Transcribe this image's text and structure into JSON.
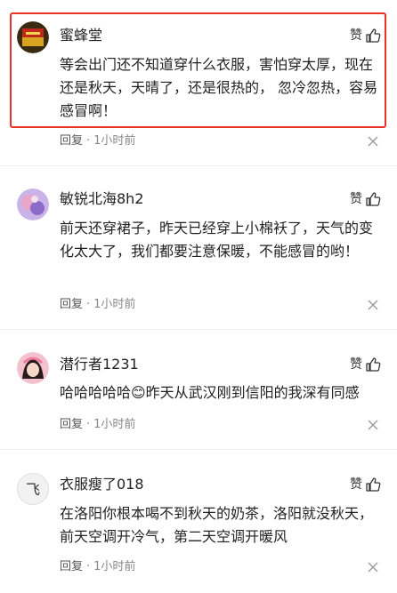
{
  "comments": [
    {
      "username": "蜜蜂堂",
      "like_label": "赞",
      "content": "等会出门还不知道穿什么衣服，害怕穿太厚，现在还是秋天，天晴了，还是很热的， 忽冷忽热，容易感冒啊！",
      "reply_label": "回复",
      "separator": "·",
      "time": "1小时前",
      "avatar_colors": [
        "#3a2a12",
        "#d9a520"
      ]
    },
    {
      "username": "敏锐北海8h2",
      "like_label": "赞",
      "content": "前天还穿裙子，昨天已经穿上小棉袄了，天气的变化太大了，我们都要注意保暖，不能感冒的哟！",
      "reply_label": "回复",
      "separator": "·",
      "time": "1小时前",
      "avatar_colors": [
        "#b8a0e0",
        "#e8a6c8"
      ]
    },
    {
      "username": "潜行者1231",
      "like_label": "赞",
      "content": "哈哈哈哈哈😊昨天从武汉刚到信阳的我深有同感",
      "reply_label": "回复",
      "separator": "·",
      "time": "1小时前",
      "avatar_colors": [
        "#f07aa0",
        "#2a1a1a"
      ]
    },
    {
      "username": "衣服瘦了018",
      "like_label": "赞",
      "content": "在洛阳你根本喝不到秋天的奶茶，洛阳就没秋天，前天空调开冷气，第二天空调开暖风",
      "reply_label": "回复",
      "separator": "·",
      "time": "1小时前",
      "avatar_colors": [
        "#f2f2f2",
        "#333333"
      ],
      "avatar_text": "飞"
    }
  ]
}
